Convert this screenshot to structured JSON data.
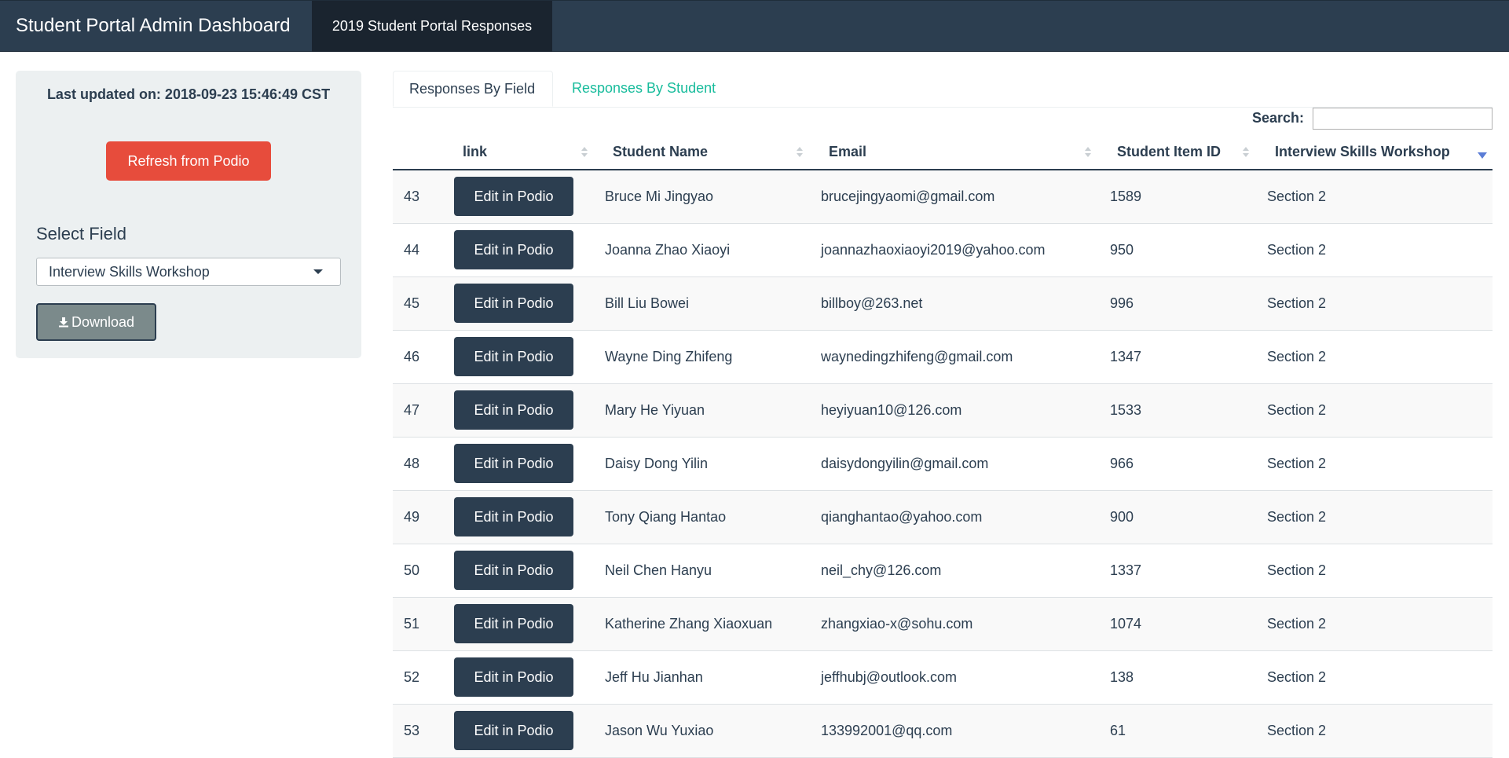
{
  "navbar": {
    "brand": "Student Portal Admin Dashboard",
    "tab": "2019 Student Portal Responses"
  },
  "sidebar": {
    "last_updated": "Last updated on: 2018-09-23 15:46:49 CST",
    "refresh_label": "Refresh from Podio",
    "select_label": "Select Field",
    "select_value": "Interview Skills Workshop",
    "download_label": "Download"
  },
  "tabs": {
    "by_field": "Responses By Field",
    "by_student": "Responses By Student"
  },
  "search": {
    "label": "Search:",
    "value": ""
  },
  "table": {
    "columns": [
      "link",
      "Student Name",
      "Email",
      "Student Item ID",
      "Interview Skills Workshop"
    ],
    "edit_label": "Edit in Podio",
    "rows": [
      {
        "n": "43",
        "name": "Bruce Mi Jingyao",
        "email": "brucejingyaomi@gmail.com",
        "id": "1589",
        "section": "Section 2"
      },
      {
        "n": "44",
        "name": "Joanna Zhao Xiaoyi",
        "email": "joannazhaoxiaoyi2019@yahoo.com",
        "id": "950",
        "section": "Section 2"
      },
      {
        "n": "45",
        "name": "Bill Liu Bowei",
        "email": "billboy@263.net",
        "id": "996",
        "section": "Section 2"
      },
      {
        "n": "46",
        "name": "Wayne Ding Zhifeng",
        "email": "waynedingzhifeng@gmail.com",
        "id": "1347",
        "section": "Section 2"
      },
      {
        "n": "47",
        "name": "Mary He Yiyuan",
        "email": "heyiyuan10@126.com",
        "id": "1533",
        "section": "Section 2"
      },
      {
        "n": "48",
        "name": "Daisy Dong Yilin",
        "email": "daisydongyilin@gmail.com",
        "id": "966",
        "section": "Section 2"
      },
      {
        "n": "49",
        "name": "Tony Qiang Hantao",
        "email": "qianghantao@yahoo.com",
        "id": "900",
        "section": "Section 2"
      },
      {
        "n": "50",
        "name": "Neil Chen Hanyu",
        "email": "neil_chy@126.com",
        "id": "1337",
        "section": "Section 2"
      },
      {
        "n": "51",
        "name": "Katherine Zhang Xiaoxuan",
        "email": "zhangxiao-x@sohu.com",
        "id": "1074",
        "section": "Section 2"
      },
      {
        "n": "52",
        "name": "Jeff Hu Jianhan",
        "email": "jeffhubj@outlook.com",
        "id": "138",
        "section": "Section 2"
      },
      {
        "n": "53",
        "name": "Jason Wu Yuxiao",
        "email": "133992001@qq.com",
        "id": "61",
        "section": "Section 2"
      }
    ]
  }
}
